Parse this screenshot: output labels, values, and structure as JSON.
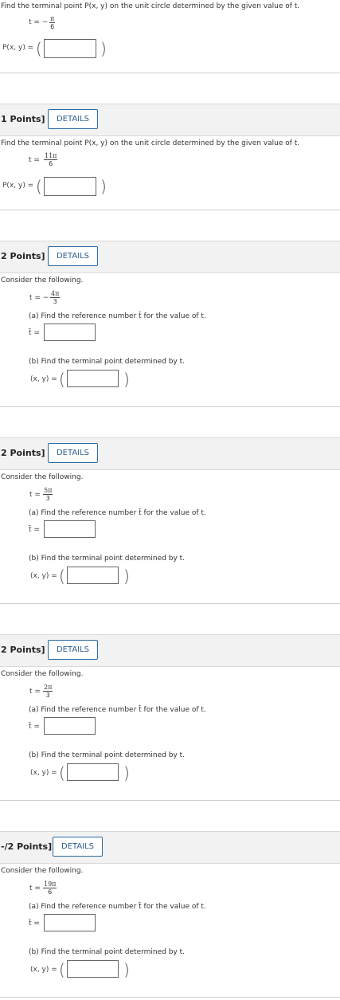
{
  "q1": {
    "instruction": "Find the terminal point P(x, y) on the unit circle determined by the given value of t.",
    "t_sign": "t = −",
    "t_num": "π",
    "t_den": "6",
    "answer_label": "P(x, y) =",
    "answer_value": ""
  },
  "q2": {
    "points": "1 Points]",
    "details": "DETAILS",
    "instruction": "Find the terminal point P(x, y) on the unit circle determined by the given value of t.",
    "t_sign": "t =",
    "t_num": "11π",
    "t_den": "6",
    "answer_label": "P(x, y) =",
    "answer_value": ""
  },
  "q3": {
    "points": "2 Points]",
    "details": "DETAILS",
    "intro": "Consider the following.",
    "t_sign": "t = −",
    "t_num": "4π",
    "t_den": "3",
    "part_a": "(a) Find the reference number t̄ for the value of t.",
    "tbar_label": "t̄ =",
    "part_b": "(b) Find the terminal point determined by t.",
    "xy_label": "(x, y) ="
  },
  "q4": {
    "points": "2 Points]",
    "details": "DETAILS",
    "intro": "Consider the following.",
    "t_sign": "t =",
    "t_num": "5π",
    "t_den": "3",
    "part_a": "(a) Find the reference number t̄ for the value of t.",
    "tbar_label": "t̄ =",
    "part_b": "(b) Find the terminal point determined by t.",
    "xy_label": "(x, y) ="
  },
  "q5": {
    "points": "2 Points]",
    "details": "DETAILS",
    "intro": "Consider the following.",
    "t_sign": "t =",
    "t_num": "2π",
    "t_den": "3",
    "part_a": "(a) Find the reference number t̄ for the value of t.",
    "tbar_label": "t̄ =",
    "part_b": "(b) Find the terminal point determined by t.",
    "xy_label": "(x, y) ="
  },
  "q6": {
    "points": "-/2 Points]",
    "details": "DETAILS",
    "intro": "Consider the following.",
    "t_sign": "t =",
    "t_num": "19π",
    "t_den": "6",
    "part_a": "(a) Find the reference number t̄ for the value of t.",
    "tbar_label": "t̄ =",
    "part_b": "(b) Find the terminal point determined by t.",
    "xy_label": "(x, y) ="
  },
  "paren_open": "(",
  "paren_close": ")"
}
